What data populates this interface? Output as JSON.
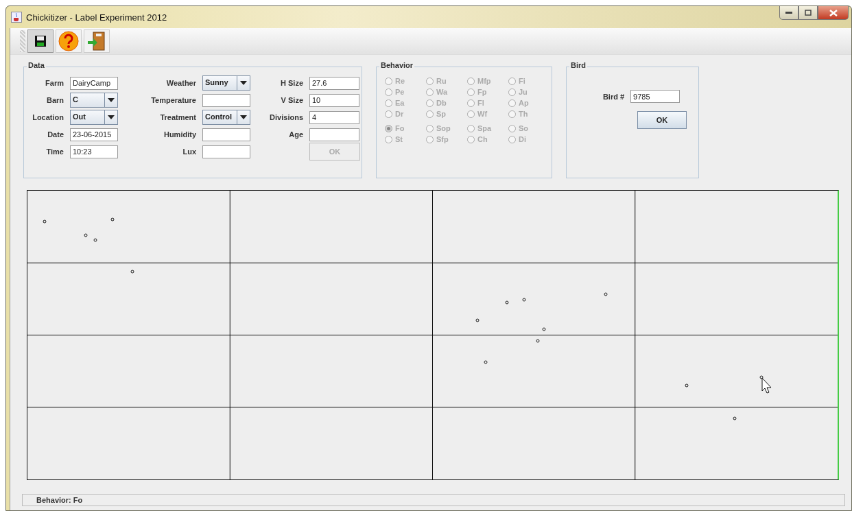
{
  "window": {
    "title": "Chickitizer - Label Experiment 2012"
  },
  "toolbar": {
    "buttons": [
      {
        "kind": "save",
        "selected": true
      },
      {
        "kind": "help",
        "selected": false
      },
      {
        "kind": "exit",
        "selected": false
      }
    ]
  },
  "data_panel": {
    "title": "Data",
    "columns": [
      [
        {
          "label": "Farm",
          "kind": "text",
          "value": "DairyCamp"
        },
        {
          "label": "Barn",
          "kind": "combo",
          "value": "C"
        },
        {
          "label": "Location",
          "kind": "combo",
          "value": "Out"
        },
        {
          "label": "Date",
          "kind": "text",
          "value": "23-06-2015"
        },
        {
          "label": "Time",
          "kind": "text",
          "value": "10:23"
        }
      ],
      [
        {
          "label": "Weather",
          "kind": "combo",
          "value": "Sunny"
        },
        {
          "label": "Temperature",
          "kind": "text"
        },
        {
          "label": "Treatment",
          "kind": "combo",
          "value": "Control"
        },
        {
          "label": "Humidity",
          "kind": "text"
        },
        {
          "label": "Lux",
          "kind": "text"
        }
      ],
      [
        {
          "label": "H Size",
          "kind": "text",
          "value": "27.6"
        },
        {
          "label": "V Size",
          "kind": "text",
          "value": "10"
        },
        {
          "label": "Divisions",
          "kind": "text",
          "value": "4"
        },
        {
          "label": "Age",
          "kind": "text"
        },
        {
          "label": "OK",
          "kind": "button",
          "disabled": true
        }
      ]
    ]
  },
  "behavior_panel": {
    "title": "Behavior",
    "disabled": true,
    "groups": [
      [
        {
          "label": "Re",
          "selected": false
        },
        {
          "label": "Ru",
          "selected": false
        },
        {
          "label": "Mfp",
          "selected": false
        },
        {
          "label": "Fi",
          "selected": false
        },
        {
          "label": "Pe",
          "selected": false
        },
        {
          "label": "Wa",
          "selected": false
        },
        {
          "label": "Fp",
          "selected": false
        },
        {
          "label": "Ju",
          "selected": false
        },
        {
          "label": "Ea",
          "selected": false
        },
        {
          "label": "Db",
          "selected": false
        },
        {
          "label": "Fl",
          "selected": false
        },
        {
          "label": "Ap",
          "selected": false
        },
        {
          "label": "Dr",
          "selected": false
        },
        {
          "label": "Sp",
          "selected": false
        },
        {
          "label": "Wf",
          "selected": false
        },
        {
          "label": "Th",
          "selected": false
        }
      ],
      [
        {
          "label": "Fo",
          "selected": true
        },
        {
          "label": "Sop",
          "selected": false
        },
        {
          "label": "Spa",
          "selected": false
        },
        {
          "label": "So",
          "selected": false
        },
        {
          "label": "St",
          "selected": false
        },
        {
          "label": "Sfp",
          "selected": false
        },
        {
          "label": "Ch",
          "selected": false
        },
        {
          "label": "Di",
          "selected": false
        }
      ]
    ]
  },
  "bird_panel": {
    "title": "Bird",
    "label": "Bird #",
    "value": "9785",
    "button": "OK"
  },
  "status_bar": {
    "text": "Behavior: Fo"
  }
}
